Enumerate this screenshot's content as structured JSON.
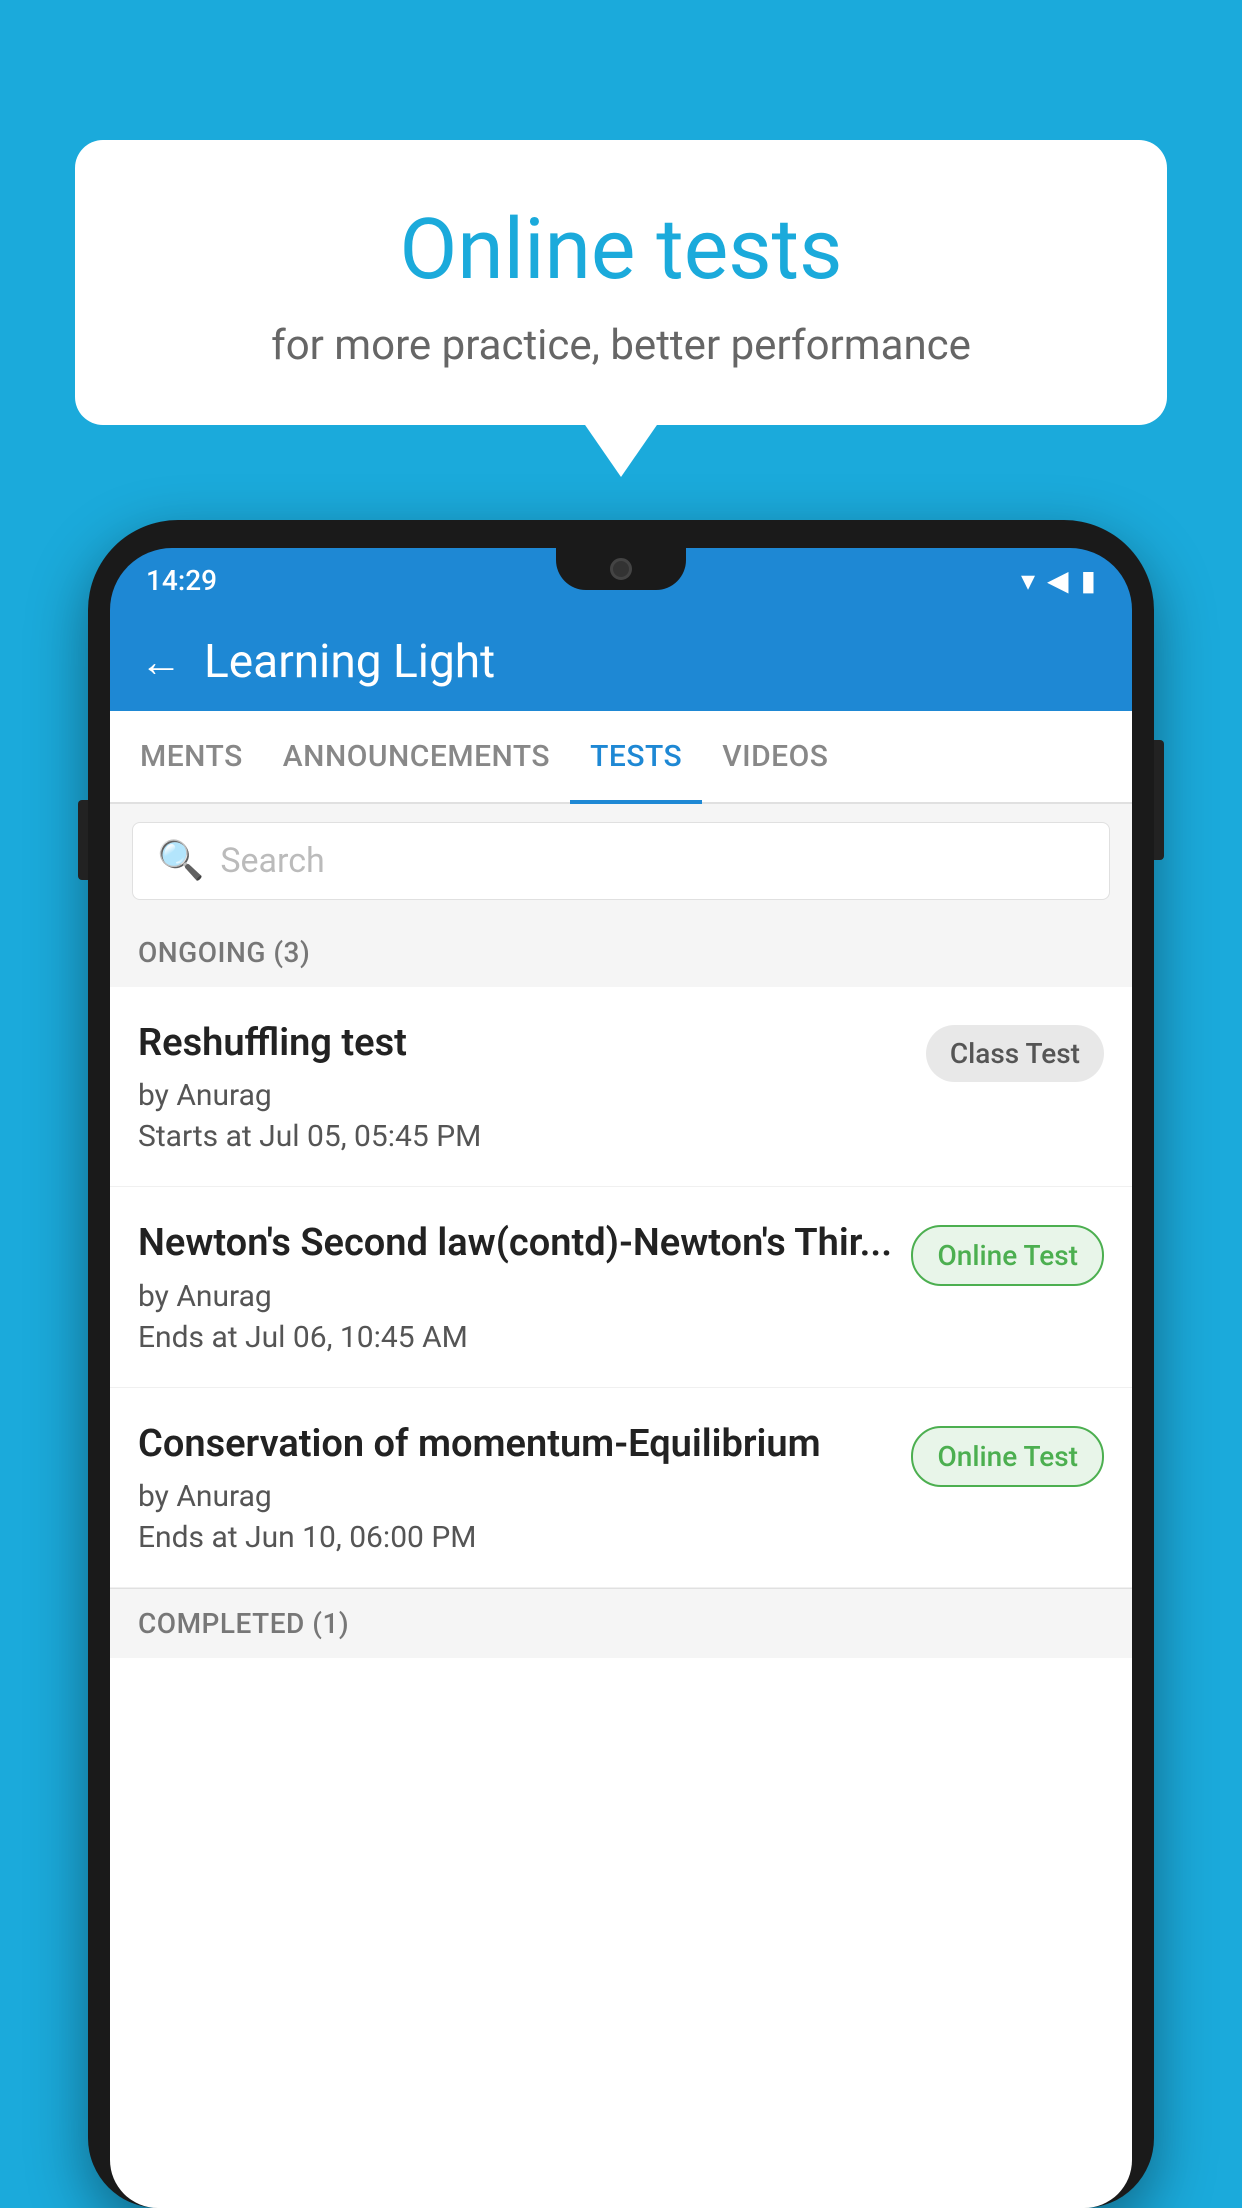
{
  "background_color": "#1BAADB",
  "bubble": {
    "title": "Online tests",
    "subtitle": "for more practice, better performance"
  },
  "phone": {
    "status_bar": {
      "time": "14:29",
      "icons": [
        "wifi",
        "signal",
        "battery"
      ]
    },
    "header": {
      "title": "Learning Light",
      "back_label": "←"
    },
    "tabs": [
      {
        "label": "MENTS",
        "active": false
      },
      {
        "label": "ANNOUNCEMENTS",
        "active": false
      },
      {
        "label": "TESTS",
        "active": true
      },
      {
        "label": "VIDEOS",
        "active": false
      }
    ],
    "search": {
      "placeholder": "Search"
    },
    "ongoing_section": {
      "label": "ONGOING (3)"
    },
    "test_items": [
      {
        "name": "Reshuffling test",
        "author": "by Anurag",
        "date": "Starts at  Jul 05, 05:45 PM",
        "badge": "Class Test",
        "badge_type": "class"
      },
      {
        "name": "Newton's Second law(contd)-Newton's Thir...",
        "author": "by Anurag",
        "date": "Ends at  Jul 06, 10:45 AM",
        "badge": "Online Test",
        "badge_type": "online"
      },
      {
        "name": "Conservation of momentum-Equilibrium",
        "author": "by Anurag",
        "date": "Ends at  Jun 10, 06:00 PM",
        "badge": "Online Test",
        "badge_type": "online"
      }
    ],
    "completed_section": {
      "label": "COMPLETED (1)"
    }
  }
}
